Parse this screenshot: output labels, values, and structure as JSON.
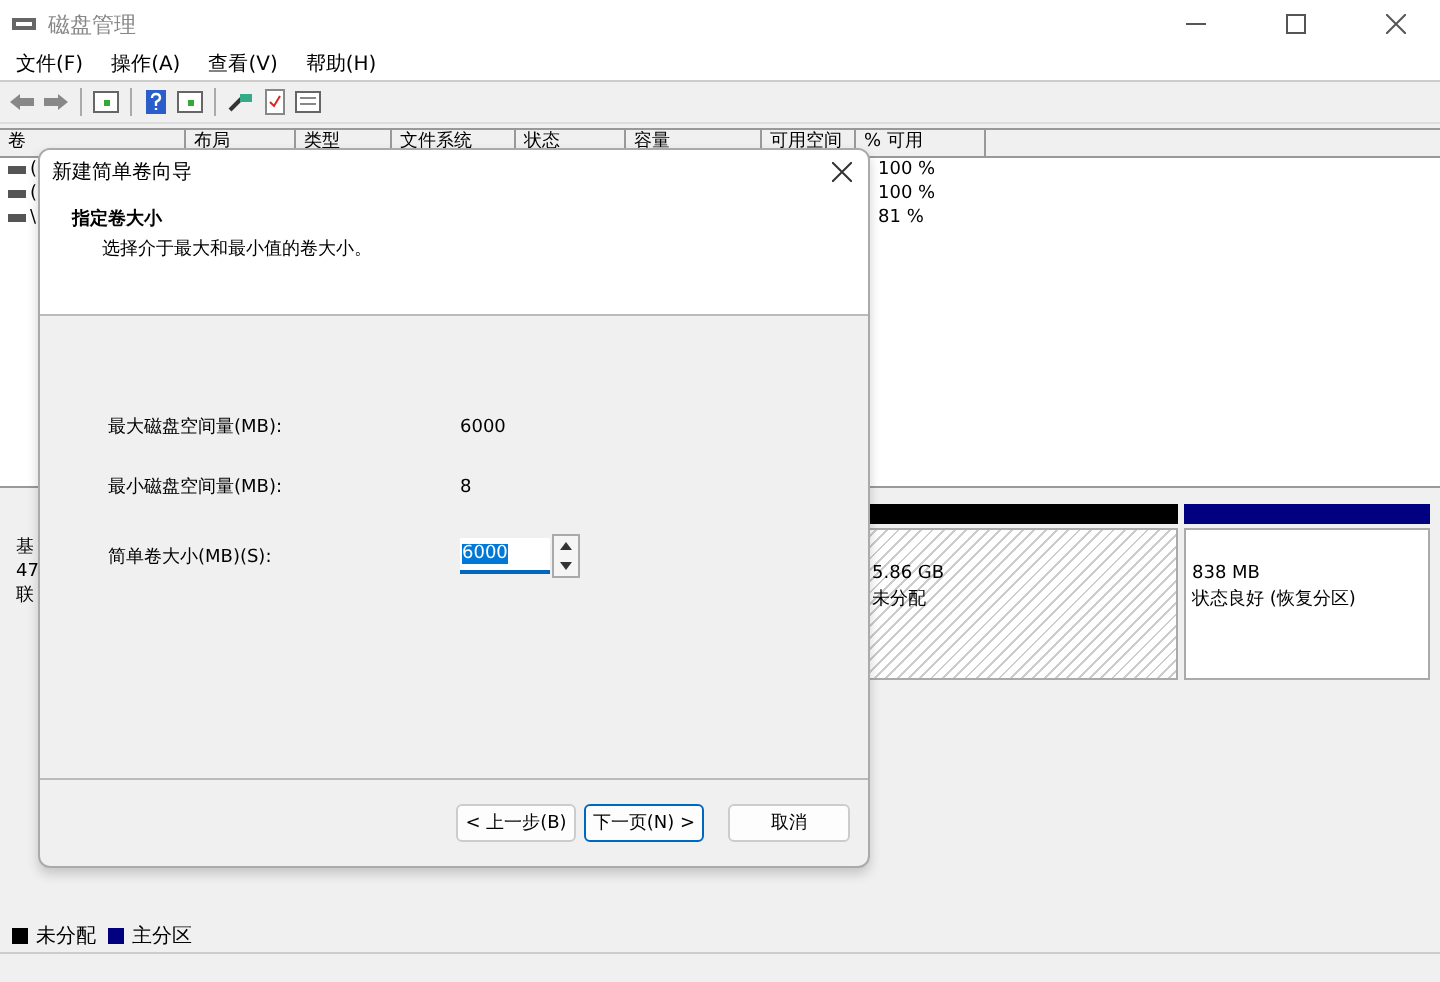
{
  "window": {
    "title": "磁盘管理"
  },
  "menu": [
    "文件(F)",
    "操作(A)",
    "查看(V)",
    "帮助(H)"
  ],
  "table": {
    "columns": [
      "卷",
      "布局",
      "类型",
      "文件系统",
      "状态",
      "容量",
      "可用空间",
      "% 可用"
    ],
    "rows": [
      {
        "volume": "(",
        "percent_free": "100 %"
      },
      {
        "volume": "(",
        "percent_free": "100 %"
      },
      {
        "volume": "\\",
        "percent_free": "81 %"
      }
    ]
  },
  "disk": {
    "label_lines": [
      "基",
      "47",
      "联"
    ],
    "partitions": [
      {
        "kind": "unallocated",
        "size": "5.86 GB",
        "status": "未分配"
      },
      {
        "kind": "primary",
        "size": "838 MB",
        "status": "状态良好 (恢复分区)"
      }
    ]
  },
  "legend": [
    {
      "label": "未分配",
      "color": "#000000"
    },
    {
      "label": "主分区",
      "color": "#000080"
    }
  ],
  "dialog": {
    "title": "新建简单卷向导",
    "heading": "指定卷大小",
    "subheading": "选择介于最大和最小值的卷大小。",
    "fields": [
      {
        "kind": "readout",
        "label": "最大磁盘空间量(MB):",
        "value": "6000"
      },
      {
        "kind": "readout",
        "label": "最小磁盘空间量(MB):",
        "value": "8"
      },
      {
        "kind": "spinner",
        "label": "简单卷大小(MB)(S):",
        "value": "6000"
      }
    ],
    "buttons": [
      {
        "label": "< 上一步(B)",
        "default": false
      },
      {
        "label": "下一页(N) >",
        "default": true
      },
      {
        "label": "取消",
        "default": false
      }
    ]
  }
}
